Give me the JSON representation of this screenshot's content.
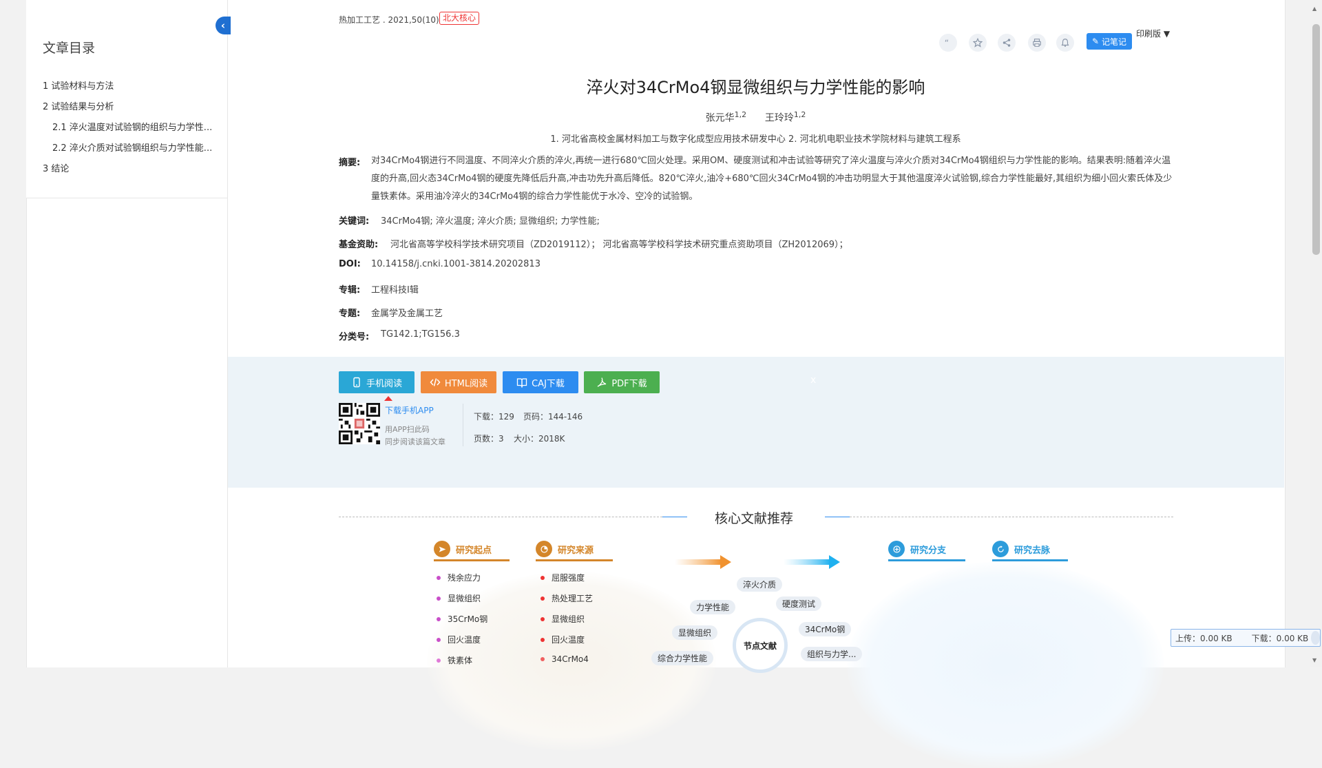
{
  "sidebar": {
    "title": "文章目录",
    "items": [
      {
        "label": "1 试验材料与方法"
      },
      {
        "label": "2 试验结果与分析"
      },
      {
        "label": "2.1 淬火温度对试验钢的组织与力学性..."
      },
      {
        "label": "2.2 淬火介质对试验钢组织与力学性能..."
      },
      {
        "label": "3 结论"
      }
    ]
  },
  "header": {
    "journal": "热加工工艺 . 2021,50(10)",
    "badge": "北大核心",
    "note_label": "记笔记",
    "print_label": "印刷版 ▼"
  },
  "article": {
    "title": "淬火对34CrMo4钢显微组织与力学性能的影响",
    "authors": [
      {
        "name": "张元华",
        "sup": "1,2"
      },
      {
        "name": "王玲玲",
        "sup": "1,2"
      }
    ],
    "affiliations": "1. 河北省高校金属材料加工与数字化成型应用技术研发中心  2. 河北机电职业技术学院材料与建筑工程系",
    "abstract_label": "摘要:",
    "abstract": "对34CrMo4钢进行不同温度、不同淬火介质的淬火,再统一进行680℃回火处理。采用OM、硬度测试和冲击试验等研究了淬火温度与淬火介质对34CrMo4钢组织与力学性能的影响。结果表明:随着淬火温度的升高,回火态34CrMo4钢的硬度先降低后升高,冲击功先升高后降低。820℃淬火,油冷+680℃回火34CrMo4钢的冲击功明显大于其他温度淬火试验钢,综合力学性能最好,其组织为细小回火索氏体及少量铁素体。采用油冷淬火的34CrMo4钢的综合力学性能优于水冷、空冷的试验钢。",
    "keywords_label": "关键词:",
    "keywords": "34CrMo4钢;  淬火温度;  淬火介质;  显微组织;  力学性能;",
    "fund_label": "基金资助:",
    "fund": "河北省高等学校科学技术研究项目（ZD2019112）；  河北省高等学校科学技术研究重点资助项目（ZH2012069）；",
    "doi_label": "DOI:",
    "doi": "10.14158/j.cnki.1001-3814.20202813",
    "series_label": "专辑:",
    "series": "工程科技Ⅰ辑",
    "subject_label": "专题:",
    "subject": "金属学及金属工艺",
    "class_label": "分类号:",
    "class": "TG142.1;TG156.3"
  },
  "download": {
    "buttons": [
      {
        "label": "手机阅读",
        "color": "#2aa7d6"
      },
      {
        "label": "HTML阅读",
        "color": "#f08a3c"
      },
      {
        "label": "CAJ下载",
        "color": "#2d8cf0"
      },
      {
        "label": "PDF下载",
        "color": "#4caf50"
      }
    ],
    "app_link": "下载手机APP",
    "app_hint1": "用APP扫此码",
    "app_hint2": "同步阅读该篇文章",
    "downloads": "下载：129",
    "pages_range": "页码：144-146",
    "page_count": "页数：3",
    "size": "大小：2018K",
    "close": "x"
  },
  "recommend": {
    "title": "核心文献推荐",
    "col1": {
      "heading": "研究起点",
      "color": "#d4862a",
      "items": [
        "残余应力",
        "显微组织",
        "35CrMo钢",
        "回火温度",
        "铁素体"
      ],
      "dot": "#c94fc9"
    },
    "col2": {
      "heading": "研究来源",
      "color": "#d4862a",
      "items": [
        "屈服强度",
        "热处理工艺",
        "显微组织",
        "回火温度",
        "34CrMo4"
      ],
      "dot": "#e33"
    },
    "col3": {
      "heading": "研究分支",
      "color": "#2d9cdb"
    },
    "col4": {
      "heading": "研究去脉",
      "color": "#2d9cdb"
    },
    "node": "节点文献",
    "tags": [
      "淬火介质",
      "力学性能",
      "硬度测试",
      "显微组织",
      "34CrMo钢",
      "综合力学性能",
      "组织与力学..."
    ]
  },
  "speed": {
    "upload": "上传：0.00  KB",
    "download": "下载：0.00  KB"
  }
}
